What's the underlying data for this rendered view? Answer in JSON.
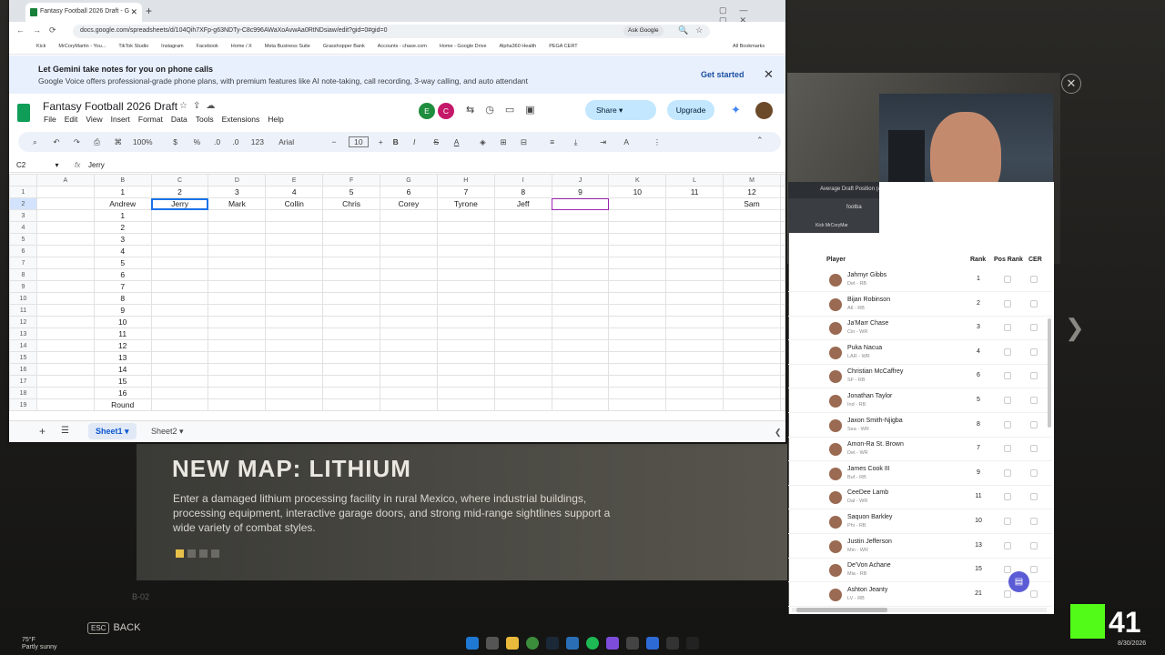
{
  "browser": {
    "tab_title": "Fantasy Football 2026 Draft - G",
    "url": "docs.google.com/spreadsheets/d/104Qih7XFp-g63NDTy-C8c996AWaXoAvwAa0RtNDsiaw/edit?gid=0#gid=0",
    "ask_google": "Ask Google",
    "bookmarks": [
      "Kick",
      "MrCoryMartin - You...",
      "TikTok Studio",
      "Instagram",
      "Facebook",
      "Home / X",
      "Meta Business Suite",
      "Grasshopper Bank",
      "Accounts - chase.com",
      "Home - Google Drive",
      "Alpha360 Health",
      "PEGA CERT"
    ],
    "all_bookmarks": "All Bookmarks"
  },
  "gemini": {
    "title": "Let Gemini take notes for you on phone calls",
    "subtitle": "Google Voice offers professional-grade phone plans, with premium features like AI note-taking, call recording, 3-way calling, and auto attendant",
    "cta": "Get started"
  },
  "sheet": {
    "title": "Fantasy Football 2026 Draft",
    "menu": [
      "File",
      "Edit",
      "View",
      "Insert",
      "Format",
      "Data",
      "Tools",
      "Extensions",
      "Help"
    ],
    "avatars": [
      {
        "letter": "E",
        "color": "#1e8e3e"
      },
      {
        "letter": "C",
        "color": "#c5186a"
      }
    ],
    "share": "Share",
    "upgrade": "Upgrade",
    "toolbar": {
      "zoom": "100%",
      "currency": "$",
      "percent": "%",
      "dec": ".0",
      "num123": "123",
      "font": "Arial",
      "size": "10"
    },
    "name_box": "C2",
    "formula_value": "Jerry",
    "columns": [
      "A",
      "B",
      "C",
      "D",
      "E",
      "F",
      "G",
      "H",
      "I",
      "J",
      "K",
      "L",
      "M"
    ],
    "row1": [
      "",
      "1",
      "2",
      "3",
      "4",
      "5",
      "6",
      "7",
      "8",
      "9",
      "10",
      "11",
      "12"
    ],
    "row2": [
      "",
      "Andrew",
      "Jerry",
      "Mark",
      "Collin",
      "Chris",
      "Corey",
      "Tyrone",
      "Jeff",
      "",
      "",
      "",
      "Sam"
    ],
    "rounds": [
      "1",
      "2",
      "3",
      "4",
      "5",
      "6",
      "7",
      "8",
      "9",
      "10",
      "11",
      "12",
      "13",
      "14",
      "15",
      "16"
    ],
    "round_label": "Round",
    "tabs": [
      "Sheet1",
      "Sheet2"
    ]
  },
  "side_panel": {
    "tab_title": "Average Draft Position (A",
    "nav_text": "footba",
    "bm_text": "Kick  MrCoryMar",
    "headers": {
      "player": "Player",
      "rank": "Rank",
      "pos_rank": "Pos Rank",
      "cer": "CER"
    },
    "players": [
      {
        "name": "Jahmyr Gibbs",
        "team": "Det - RB",
        "rank": "1"
      },
      {
        "name": "Bijan Robinson",
        "team": "Atl - RB",
        "rank": "2"
      },
      {
        "name": "Ja'Marr Chase",
        "team": "Cin - WR",
        "rank": "3"
      },
      {
        "name": "Puka Nacua",
        "team": "LAR - WR",
        "rank": "4"
      },
      {
        "name": "Christian McCaffrey",
        "team": "SF - RB",
        "rank": "6"
      },
      {
        "name": "Jonathan Taylor",
        "team": "Ind - RB",
        "rank": "5"
      },
      {
        "name": "Jaxon Smith-Njigba",
        "team": "Sea - WR",
        "rank": "8"
      },
      {
        "name": "Amon-Ra St. Brown",
        "team": "Det - WR",
        "rank": "7"
      },
      {
        "name": "James Cook III",
        "team": "Buf - RB",
        "rank": "9"
      },
      {
        "name": "CeeDee Lamb",
        "team": "Dal - WR",
        "rank": "11"
      },
      {
        "name": "Saquon Barkley",
        "team": "Phi - RB",
        "rank": "10"
      },
      {
        "name": "Justin Jefferson",
        "team": "Min - WR",
        "rank": "13"
      },
      {
        "name": "De'Von Achane",
        "team": "Mia - RB",
        "rank": "15"
      },
      {
        "name": "Ashton Jeanty",
        "team": "LV - RB",
        "rank": "21"
      }
    ]
  },
  "game": {
    "map_title": "NEW MAP: LITHIUM",
    "map_desc": "Enter a damaged lithium processing facility in rural Mexico, where industrial buildings, processing equipment, interactive garage doors, and strong mid-range sightlines support a wide variety of combat styles.",
    "faint": "B-02",
    "back_key": "ESC",
    "back": "BACK"
  },
  "stream": {
    "count": "41"
  },
  "taskbar": {
    "temp": "75°F",
    "weather": "Partly sunny",
    "date": "8/30/2026"
  }
}
